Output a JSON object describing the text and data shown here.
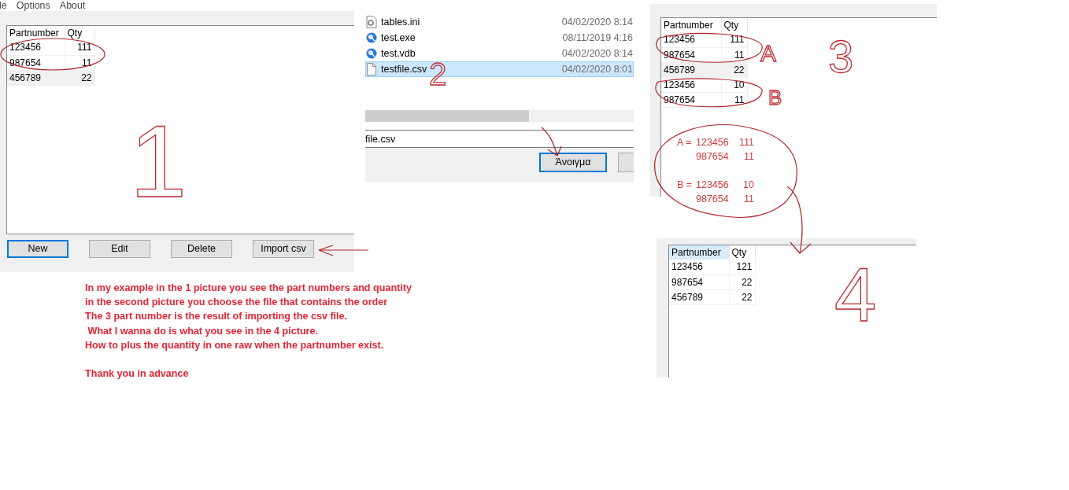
{
  "menu_bar": [
    "le",
    "Options",
    "About"
  ],
  "picture_1": {
    "columns": [
      {
        "label": "Partnumber",
        "highlighted": false
      },
      {
        "label": "Qty",
        "highlighted": false
      }
    ],
    "rows": [
      {
        "cells": [
          "123456",
          "111"
        ],
        "selected": false
      },
      {
        "cells": [
          "987654",
          "11"
        ],
        "selected": false
      },
      {
        "cells": [
          "456789",
          "22"
        ],
        "selected": true
      }
    ],
    "buttons": [
      {
        "label": "New",
        "focused": true
      },
      {
        "label": "Edit",
        "focused": false
      },
      {
        "label": "Delete",
        "focused": false
      },
      {
        "label": "Import csv",
        "focused": false
      }
    ]
  },
  "picture_2": {
    "files": [
      {
        "name": "tables.ini",
        "kind": "settings",
        "date": "04/02/2020 8:14",
        "selected": false
      },
      {
        "name": "test.exe",
        "kind": "app",
        "date": "08/11/2019 4:16",
        "selected": false
      },
      {
        "name": "test.vdb",
        "kind": "app",
        "date": "04/02/2020 8:14",
        "selected": false
      },
      {
        "name": "testfile.csv",
        "kind": "document",
        "date": "04/02/2020 8:01",
        "selected": true
      }
    ],
    "file_name": "file.csv",
    "buttons": [
      {
        "label": "Άνοιγμα",
        "focused": true
      },
      {
        "focused": false
      }
    ]
  },
  "picture_3": {
    "columns": [
      {
        "label": "Partnumber",
        "highlighted": false
      },
      {
        "label": "Qty",
        "highlighted": false
      }
    ],
    "rows": [
      {
        "cells": [
          "123456",
          "111"
        ],
        "selected": false
      },
      {
        "cells": [
          "987654",
          "11"
        ],
        "selected": false
      },
      {
        "cells": [
          "456789",
          "22"
        ],
        "selected": true
      },
      {
        "cells": [
          "123456",
          "10"
        ],
        "selected": false
      },
      {
        "cells": [
          "987654",
          "11"
        ],
        "selected": false
      }
    ],
    "notes": [
      {
        "label": "A =",
        "lines": [
          [
            "123456",
            "111"
          ],
          [
            "987654",
            "11"
          ]
        ]
      },
      {
        "label": "B =",
        "lines": [
          [
            "123456",
            "10"
          ],
          [
            "987654",
            "11"
          ]
        ]
      }
    ]
  },
  "picture_4": {
    "columns": [
      {
        "label": "Partnumber",
        "highlighted": true
      },
      {
        "label": "Qty",
        "highlighted": false
      }
    ],
    "rows": [
      {
        "cells": [
          "123456",
          "121"
        ],
        "selected": false
      },
      {
        "cells": [
          "987654",
          "22"
        ],
        "selected": false
      },
      {
        "cells": [
          "456789",
          "22"
        ],
        "selected": false
      }
    ]
  },
  "annotations": {
    "numbers": [
      "1",
      "2",
      "3",
      "4"
    ],
    "letters": [
      "A",
      "B"
    ]
  },
  "message": {
    "lines": [
      "In my example in the 1 picture you see the part numbers and quantity",
      "in the second picture you choose the file that contains the order",
      "The 3 part number is the result of importing the csv file.",
      " What I wanna do is what you see in the 4 picture.",
      "How to plus the quantity in one raw when the partnumber exist."
    ],
    "closing": "Thank you in advance"
  }
}
